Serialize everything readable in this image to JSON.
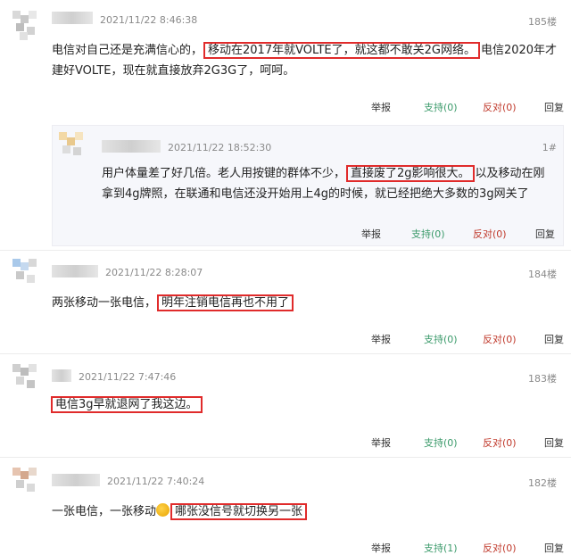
{
  "comments": [
    {
      "time": "2021/11/22 8:46:38",
      "floor": "185楼",
      "line1_pre": "电信对自己还是充满信心的，",
      "line1_hl": "移动在2017年就VOLTE了，就这都不敢关2G网络。",
      "line1_post": "电信2020年才",
      "line2": "建好VOLTE，现在就直接放弃2G3G了，呵呵。",
      "actions": {
        "report": "举报",
        "support": "支持(0)",
        "oppose": "反对(0)",
        "reply": "回复"
      }
    },
    {
      "time": "2021/11/22 18:52:30",
      "floor": "1#",
      "line1_pre": "用户体量差了好几倍。老人用按键的群体不少，",
      "line1_hl": "直接废了2g影响很大。",
      "line1_post": "以及移动在刚",
      "line2": "拿到4g牌照，在联通和电信还没开始用上4g的时候，就已经把绝大多数的3g网关了",
      "actions": {
        "report": "举报",
        "support": "支持(0)",
        "oppose": "反对(0)",
        "reply": "回复"
      }
    },
    {
      "time": "2021/11/22 8:28:07",
      "floor": "184楼",
      "line1_pre": "两张移动一张电信，",
      "line1_hl": "明年注销电信再也不用了",
      "actions": {
        "report": "举报",
        "support": "支持(0)",
        "oppose": "反对(0)",
        "reply": "回复"
      }
    },
    {
      "time": "2021/11/22 7:47:46",
      "floor": "183楼",
      "line1_hl": "电信3g早就退网了我这边。",
      "actions": {
        "report": "举报",
        "support": "支持(0)",
        "oppose": "反对(0)",
        "reply": "回复"
      }
    },
    {
      "time": "2021/11/22 7:40:24",
      "floor": "182楼",
      "line1_pre": "一张电信，一张移动",
      "line1_hl": "哪张没信号就切换另一张",
      "actions": {
        "report": "举报",
        "support": "支持(1)",
        "oppose": "反对(0)",
        "reply": "回复"
      }
    }
  ],
  "colors": {
    "highlight_border": "#e02b2b",
    "support": "#3a9a6a",
    "oppose": "#c0392b"
  },
  "icons": {
    "emoji": "emoji-icon"
  }
}
